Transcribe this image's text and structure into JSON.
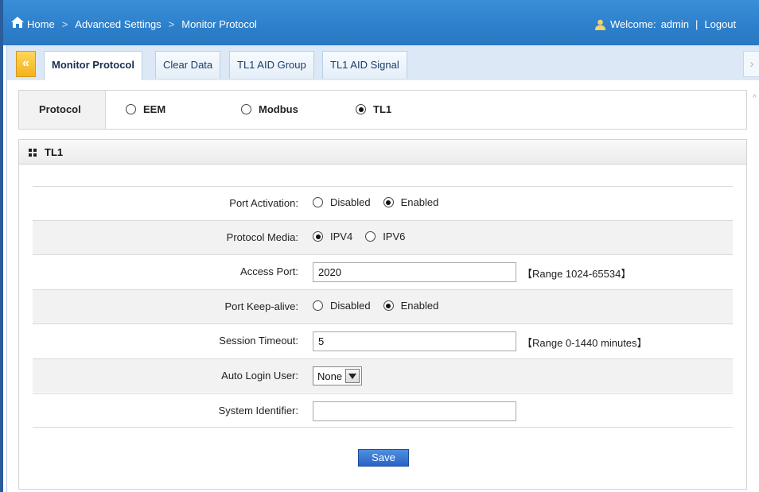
{
  "breadcrumb": {
    "items": [
      "Home",
      "Advanced Settings",
      "Monitor Protocol"
    ],
    "separator": ">"
  },
  "header": {
    "welcome_label": "Welcome:",
    "username": "admin",
    "divider": "|",
    "logout_label": "Logout"
  },
  "tabs": {
    "prev_icon": "«",
    "next_icon": "›",
    "items": [
      "Monitor Protocol",
      "Clear Data",
      "TL1 AID Group",
      "TL1 AID Signal"
    ],
    "active": "Monitor Protocol"
  },
  "protocol": {
    "label": "Protocol",
    "options": [
      "EEM",
      "Modbus",
      "TL1"
    ],
    "selected": "TL1"
  },
  "section": {
    "title": "TL1",
    "icon": "grid-icon"
  },
  "form": {
    "port_activation": {
      "label": "Port Activation:",
      "options": [
        "Disabled",
        "Enabled"
      ],
      "selected": "Enabled"
    },
    "protocol_media": {
      "label": "Protocol Media:",
      "options": [
        "IPV4",
        "IPV6"
      ],
      "selected": "IPV4"
    },
    "access_port": {
      "label": "Access Port:",
      "value": "2020",
      "range": "【Range 1024-65534】"
    },
    "port_keepalive": {
      "label": "Port Keep-alive:",
      "options": [
        "Disabled",
        "Enabled"
      ],
      "selected": "Enabled"
    },
    "session_timeout": {
      "label": "Session Timeout:",
      "value": "5",
      "range": "【Range 0-1440 minutes】"
    },
    "auto_login_user": {
      "label": "Auto Login User:",
      "value": "None"
    },
    "system_identifier": {
      "label": "System Identifier:",
      "value": ""
    }
  },
  "save_label": "Save",
  "colors": {
    "header_blue": "#2d7fca",
    "tab_bar": "#dce8f5",
    "prev_tab_orange": "#f3b21e",
    "alt_row": "#f2f2f2",
    "save_button": "#2a63c4"
  }
}
